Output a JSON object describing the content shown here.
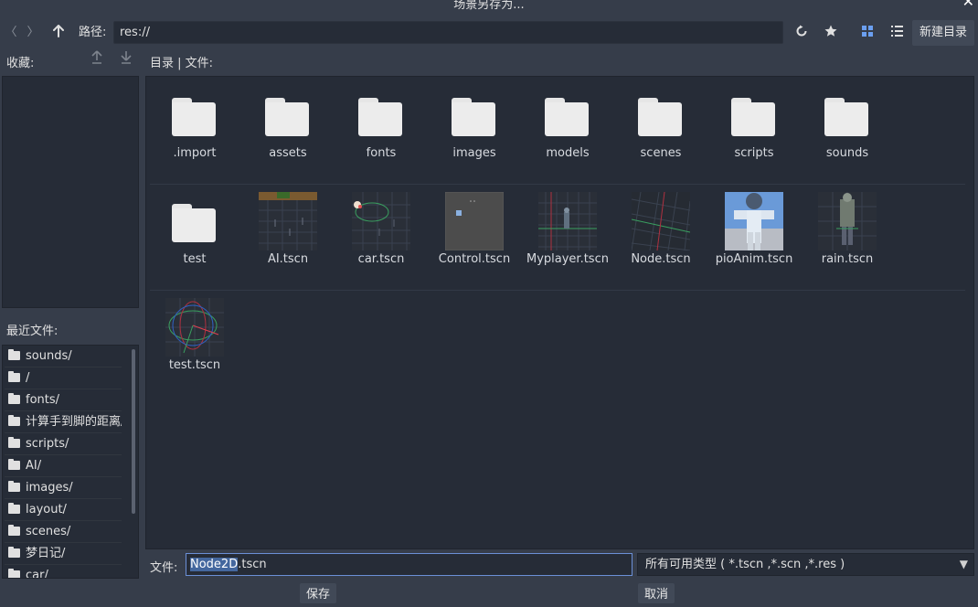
{
  "window": {
    "title": "场景另存为..."
  },
  "toolbar": {
    "back_icon": "〈",
    "forward_icon": "〉",
    "up_icon": "arrow-up-icon",
    "path_label": "路径:",
    "path_value": "res://",
    "new_dir_label": "新建目录"
  },
  "sidebar": {
    "favorites_label": "收藏:",
    "recent_label": "最近文件:",
    "recent_items": [
      "sounds/",
      "/",
      "fonts/",
      "计算手到脚的距离/",
      "scripts/",
      "AI/",
      "images/",
      "layout/",
      "scenes/",
      "梦日记/",
      "car/"
    ]
  },
  "main": {
    "dir_label": "目录 | 文件:",
    "folders": [
      ".import",
      "assets",
      "fonts",
      "images",
      "models",
      "scenes",
      "scripts",
      "sounds",
      "test"
    ],
    "scenes": [
      "AI.tscn",
      "car.tscn",
      "Control.tscn",
      "Myplayer.tscn",
      "Node.tscn",
      "pioAnim.tscn",
      "rain.tscn",
      "test.tscn"
    ]
  },
  "bottom": {
    "file_label": "文件:",
    "filename_selected": "Node2D",
    "filename_rest": ".tscn",
    "filter_value": "所有可用类型 ( *.tscn ,*.scn ,*.res )",
    "save_label": "保存",
    "cancel_label": "取消"
  },
  "colors": {
    "background": "#363d4a",
    "panel": "#262c37",
    "accent": "#6b8fd6"
  }
}
